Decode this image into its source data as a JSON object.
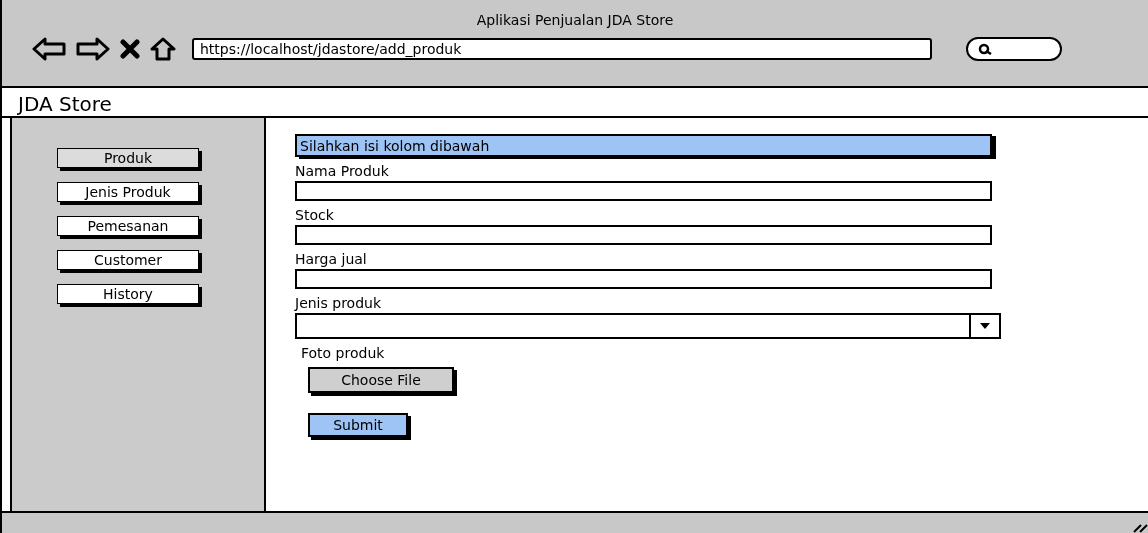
{
  "window": {
    "title": "Aplikasi Penjualan JDA Store",
    "url": "https://localhost/jdastore/add_produk"
  },
  "app": {
    "title": "JDA Store"
  },
  "sidebar": {
    "items": [
      {
        "label": "Produk",
        "selected": true
      },
      {
        "label": "Jenis Produk",
        "selected": false
      },
      {
        "label": "Pemesanan",
        "selected": false
      },
      {
        "label": "Customer",
        "selected": false
      },
      {
        "label": "History",
        "selected": false
      }
    ]
  },
  "form": {
    "heading": "Silahkan isi kolom dibawah",
    "fields": [
      {
        "kind": "text",
        "label": "Nama Produk"
      },
      {
        "kind": "text",
        "label": "Stock"
      },
      {
        "kind": "text",
        "label": "Harga jual"
      },
      {
        "kind": "select",
        "label": "Jenis produk"
      },
      {
        "kind": "file",
        "label": "Foto produk",
        "button": "Choose File"
      }
    ],
    "submit": "Submit"
  }
}
